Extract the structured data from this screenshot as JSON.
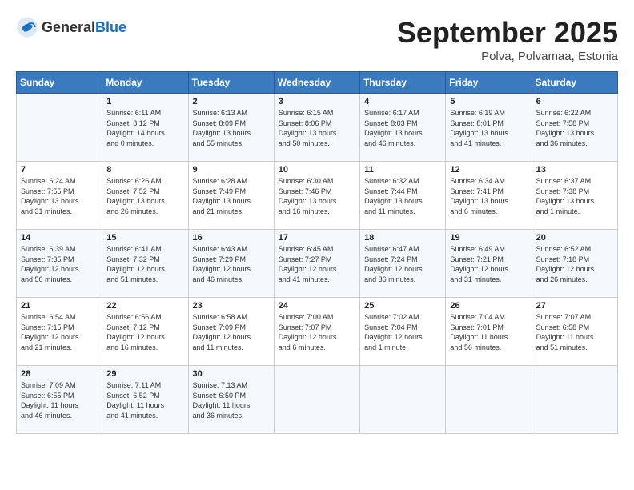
{
  "header": {
    "logo_general": "General",
    "logo_blue": "Blue",
    "month": "September 2025",
    "location": "Polva, Polvamaa, Estonia"
  },
  "weekdays": [
    "Sunday",
    "Monday",
    "Tuesday",
    "Wednesday",
    "Thursday",
    "Friday",
    "Saturday"
  ],
  "weeks": [
    [
      {
        "day": "",
        "info": ""
      },
      {
        "day": "1",
        "info": "Sunrise: 6:11 AM\nSunset: 8:12 PM\nDaylight: 14 hours\nand 0 minutes."
      },
      {
        "day": "2",
        "info": "Sunrise: 6:13 AM\nSunset: 8:09 PM\nDaylight: 13 hours\nand 55 minutes."
      },
      {
        "day": "3",
        "info": "Sunrise: 6:15 AM\nSunset: 8:06 PM\nDaylight: 13 hours\nand 50 minutes."
      },
      {
        "day": "4",
        "info": "Sunrise: 6:17 AM\nSunset: 8:03 PM\nDaylight: 13 hours\nand 46 minutes."
      },
      {
        "day": "5",
        "info": "Sunrise: 6:19 AM\nSunset: 8:01 PM\nDaylight: 13 hours\nand 41 minutes."
      },
      {
        "day": "6",
        "info": "Sunrise: 6:22 AM\nSunset: 7:58 PM\nDaylight: 13 hours\nand 36 minutes."
      }
    ],
    [
      {
        "day": "7",
        "info": "Sunrise: 6:24 AM\nSunset: 7:55 PM\nDaylight: 13 hours\nand 31 minutes."
      },
      {
        "day": "8",
        "info": "Sunrise: 6:26 AM\nSunset: 7:52 PM\nDaylight: 13 hours\nand 26 minutes."
      },
      {
        "day": "9",
        "info": "Sunrise: 6:28 AM\nSunset: 7:49 PM\nDaylight: 13 hours\nand 21 minutes."
      },
      {
        "day": "10",
        "info": "Sunrise: 6:30 AM\nSunset: 7:46 PM\nDaylight: 13 hours\nand 16 minutes."
      },
      {
        "day": "11",
        "info": "Sunrise: 6:32 AM\nSunset: 7:44 PM\nDaylight: 13 hours\nand 11 minutes."
      },
      {
        "day": "12",
        "info": "Sunrise: 6:34 AM\nSunset: 7:41 PM\nDaylight: 13 hours\nand 6 minutes."
      },
      {
        "day": "13",
        "info": "Sunrise: 6:37 AM\nSunset: 7:38 PM\nDaylight: 13 hours\nand 1 minute."
      }
    ],
    [
      {
        "day": "14",
        "info": "Sunrise: 6:39 AM\nSunset: 7:35 PM\nDaylight: 12 hours\nand 56 minutes."
      },
      {
        "day": "15",
        "info": "Sunrise: 6:41 AM\nSunset: 7:32 PM\nDaylight: 12 hours\nand 51 minutes."
      },
      {
        "day": "16",
        "info": "Sunrise: 6:43 AM\nSunset: 7:29 PM\nDaylight: 12 hours\nand 46 minutes."
      },
      {
        "day": "17",
        "info": "Sunrise: 6:45 AM\nSunset: 7:27 PM\nDaylight: 12 hours\nand 41 minutes."
      },
      {
        "day": "18",
        "info": "Sunrise: 6:47 AM\nSunset: 7:24 PM\nDaylight: 12 hours\nand 36 minutes."
      },
      {
        "day": "19",
        "info": "Sunrise: 6:49 AM\nSunset: 7:21 PM\nDaylight: 12 hours\nand 31 minutes."
      },
      {
        "day": "20",
        "info": "Sunrise: 6:52 AM\nSunset: 7:18 PM\nDaylight: 12 hours\nand 26 minutes."
      }
    ],
    [
      {
        "day": "21",
        "info": "Sunrise: 6:54 AM\nSunset: 7:15 PM\nDaylight: 12 hours\nand 21 minutes."
      },
      {
        "day": "22",
        "info": "Sunrise: 6:56 AM\nSunset: 7:12 PM\nDaylight: 12 hours\nand 16 minutes."
      },
      {
        "day": "23",
        "info": "Sunrise: 6:58 AM\nSunset: 7:09 PM\nDaylight: 12 hours\nand 11 minutes."
      },
      {
        "day": "24",
        "info": "Sunrise: 7:00 AM\nSunset: 7:07 PM\nDaylight: 12 hours\nand 6 minutes."
      },
      {
        "day": "25",
        "info": "Sunrise: 7:02 AM\nSunset: 7:04 PM\nDaylight: 12 hours\nand 1 minute."
      },
      {
        "day": "26",
        "info": "Sunrise: 7:04 AM\nSunset: 7:01 PM\nDaylight: 11 hours\nand 56 minutes."
      },
      {
        "day": "27",
        "info": "Sunrise: 7:07 AM\nSunset: 6:58 PM\nDaylight: 11 hours\nand 51 minutes."
      }
    ],
    [
      {
        "day": "28",
        "info": "Sunrise: 7:09 AM\nSunset: 6:55 PM\nDaylight: 11 hours\nand 46 minutes."
      },
      {
        "day": "29",
        "info": "Sunrise: 7:11 AM\nSunset: 6:52 PM\nDaylight: 11 hours\nand 41 minutes."
      },
      {
        "day": "30",
        "info": "Sunrise: 7:13 AM\nSunset: 6:50 PM\nDaylight: 11 hours\nand 36 minutes."
      },
      {
        "day": "",
        "info": ""
      },
      {
        "day": "",
        "info": ""
      },
      {
        "day": "",
        "info": ""
      },
      {
        "day": "",
        "info": ""
      }
    ]
  ]
}
